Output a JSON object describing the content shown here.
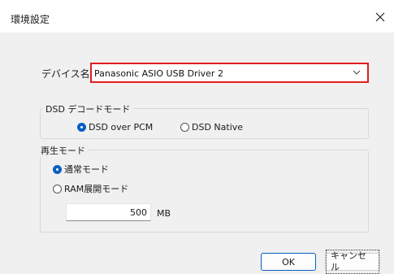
{
  "window": {
    "title": "環境設定",
    "close_icon": "close-icon"
  },
  "device": {
    "label": "デバイス名",
    "selected": "Panasonic ASIO USB Driver 2"
  },
  "dsd_group": {
    "title": "DSD デコードモード",
    "options": [
      {
        "label": "DSD over PCM",
        "checked": true
      },
      {
        "label": "DSD Native",
        "checked": false
      }
    ]
  },
  "playback_group": {
    "title": "再生モード",
    "options": [
      {
        "label": "通常モード",
        "checked": true
      },
      {
        "label": "RAM展開モード",
        "checked": false
      }
    ],
    "memory_value": "500",
    "memory_unit": "MB"
  },
  "buttons": {
    "ok": "OK",
    "cancel": "キャンセル"
  },
  "colors": {
    "highlight": "#e01e1e",
    "accent": "#0a5ec2"
  }
}
